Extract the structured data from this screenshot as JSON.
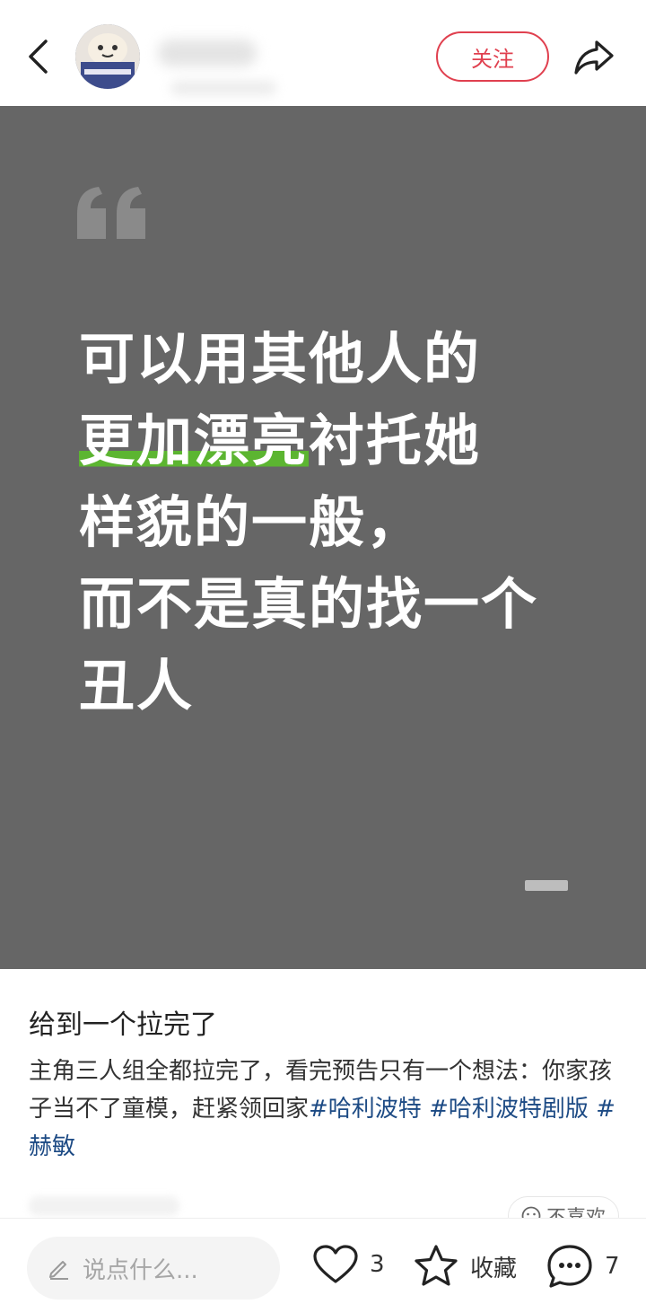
{
  "header": {
    "follow_label": "关注"
  },
  "post_image": {
    "lines": [
      {
        "plain": "可以用其他人的",
        "highlight": ""
      },
      {
        "highlight": "更加漂亮",
        "plain": "衬托她"
      },
      {
        "plain": "样貌的一般，",
        "highlight": ""
      },
      {
        "plain": "而不是真的找一个",
        "highlight": ""
      },
      {
        "plain": "丑人",
        "highlight": ""
      }
    ],
    "background": "#666666",
    "highlight_color": "#5cb531"
  },
  "post": {
    "title": "给到一个拉完了",
    "body": "主角三人组全都拉完了，看完预告只有一个想法：你家孩子当不了童模，赶紧领回家",
    "tags": [
      "#哈利波特",
      "#哈利波特剧版",
      "#赫敏"
    ],
    "dislike_label": "不喜欢"
  },
  "bottom_bar": {
    "comment_placeholder": "说点什么...",
    "like_count": "3",
    "favorite_label": "收藏",
    "comment_count": "7"
  },
  "colors": {
    "accent": "#e0404f",
    "tag": "#1c4a84"
  }
}
